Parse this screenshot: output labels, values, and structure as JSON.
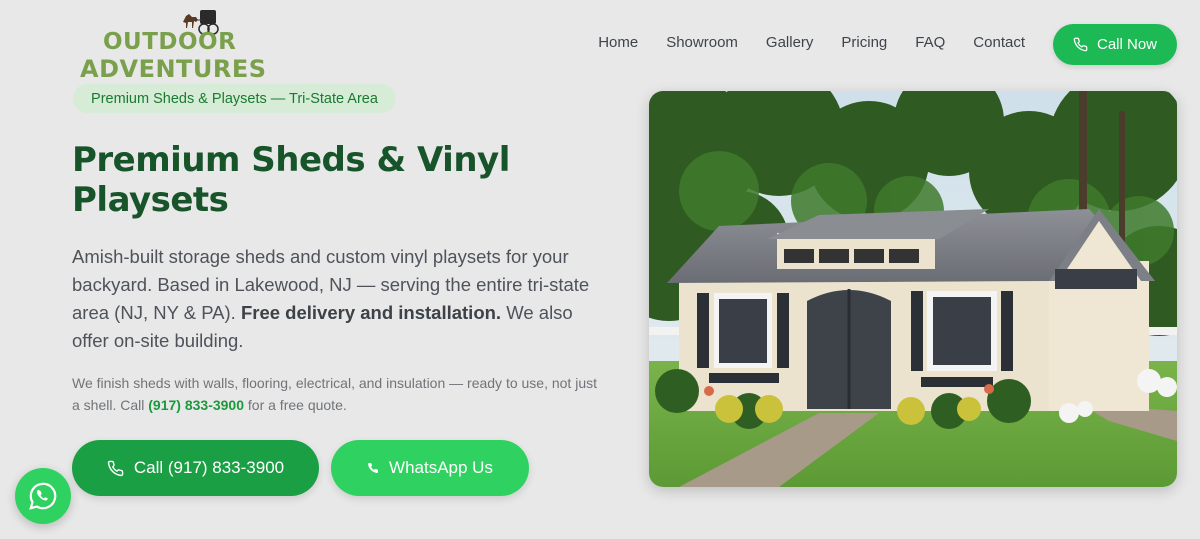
{
  "brand": {
    "line1": "OUTDOOR",
    "line2": "ADVENTURES"
  },
  "nav": {
    "items": [
      "Home",
      "Showroom",
      "Gallery",
      "Pricing",
      "FAQ",
      "Contact"
    ],
    "cta_label": "Call Now"
  },
  "hero": {
    "badge": "Premium Sheds & Playsets — Tri-State Area",
    "title": "Premium Sheds & Vinyl Playsets",
    "lead_text": "Amish-built storage sheds and custom vinyl playsets for your backyard. Based in Lakewood, NJ — serving the entire tri-state area (NJ, NY & PA).",
    "lead_bold": "Free delivery and installation.",
    "lead_tail": "We also offer on-site building.",
    "sub_text_before": "We finish sheds with walls, flooring, electrical, and insulation — ready to use, not just a shell. Call",
    "sub_phone": "(917) 833-3900",
    "sub_text_after": "for a free quote.",
    "call_button": "Call (917) 833-3900",
    "whatsapp_button": "WhatsApp Us"
  },
  "icons": {
    "phone": "phone-icon",
    "whatsapp": "whatsapp-icon",
    "buggy": "horse-buggy-icon"
  },
  "colors": {
    "brand_green": "#7aa04c",
    "heading_green": "#17542a",
    "cta_green": "#1db954",
    "call_button": "#1b9f45",
    "whatsapp_green": "#2fd260",
    "badge_bg": "#d6ecd6",
    "page_bg": "#e8e8e8"
  }
}
